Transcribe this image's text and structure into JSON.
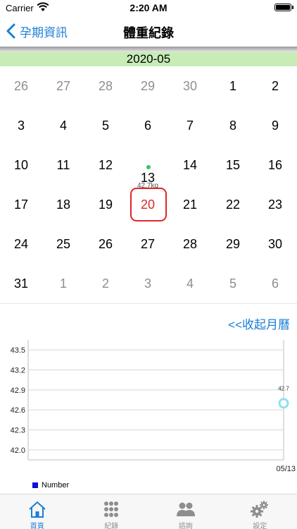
{
  "status": {
    "carrier": "Carrier",
    "time": "2:20 AM"
  },
  "nav": {
    "back_label": "孕期資訊",
    "title": "體重紀錄"
  },
  "calendar": {
    "month": "2020-05",
    "weeks": [
      [
        {
          "d": "26",
          "other": true
        },
        {
          "d": "27",
          "other": true
        },
        {
          "d": "28",
          "other": true
        },
        {
          "d": "29",
          "other": true
        },
        {
          "d": "30",
          "other": true
        },
        {
          "d": "1"
        },
        {
          "d": "2"
        }
      ],
      [
        {
          "d": "3"
        },
        {
          "d": "4"
        },
        {
          "d": "5"
        },
        {
          "d": "6"
        },
        {
          "d": "7"
        },
        {
          "d": "8"
        },
        {
          "d": "9"
        }
      ],
      [
        {
          "d": "10"
        },
        {
          "d": "11"
        },
        {
          "d": "12"
        },
        {
          "d": "13",
          "marked": true,
          "weight": "42.7kg"
        },
        {
          "d": "14"
        },
        {
          "d": "15"
        },
        {
          "d": "16"
        }
      ],
      [
        {
          "d": "17"
        },
        {
          "d": "18"
        },
        {
          "d": "19"
        },
        {
          "d": "20",
          "selected": true
        },
        {
          "d": "21"
        },
        {
          "d": "22"
        },
        {
          "d": "23"
        }
      ],
      [
        {
          "d": "24"
        },
        {
          "d": "25"
        },
        {
          "d": "26"
        },
        {
          "d": "27"
        },
        {
          "d": "28"
        },
        {
          "d": "29"
        },
        {
          "d": "30"
        }
      ],
      [
        {
          "d": "31"
        },
        {
          "d": "1",
          "other": true
        },
        {
          "d": "2",
          "other": true
        },
        {
          "d": "3",
          "other": true
        },
        {
          "d": "4",
          "other": true
        },
        {
          "d": "5",
          "other": true
        },
        {
          "d": "6",
          "other": true
        }
      ]
    ]
  },
  "collapse_label": "<<收起月曆",
  "chart_data": {
    "type": "line",
    "y_ticks": [
      "43.5",
      "43.2",
      "42.9",
      "42.6",
      "42.3",
      "42.0"
    ],
    "ylim": [
      41.85,
      43.65
    ],
    "x_tick": "05/13",
    "series": [
      {
        "name": "Number",
        "color": "#1010d4",
        "points": [
          {
            "x": "05/13",
            "y": 42.7,
            "label": "42.7"
          }
        ]
      }
    ]
  },
  "tabs": [
    {
      "label": "首頁",
      "icon": "home-icon",
      "active": true
    },
    {
      "label": "紀錄",
      "icon": "grid-icon",
      "active": false
    },
    {
      "label": "諮詢",
      "icon": "people-icon",
      "active": false
    },
    {
      "label": "設定",
      "icon": "gears-icon",
      "active": false
    }
  ],
  "colors": {
    "accent": "#1a7fd6",
    "selected": "#e02626",
    "month_bg": "#c7ecb6",
    "marker": "#3cc45a"
  }
}
